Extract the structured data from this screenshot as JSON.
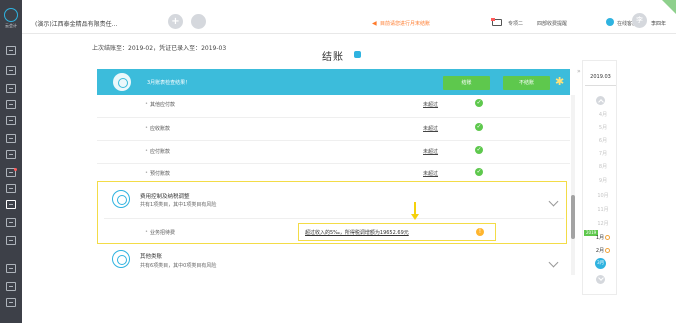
{
  "app": {
    "logo_text": "云会计"
  },
  "header": {
    "company": "(演示)江西泰金精品有限责任...",
    "add_symbol": "+",
    "notice": "目前请您进行月末结账",
    "links": [
      "专项二",
      "四部收费提醒",
      "在线客服"
    ],
    "avatar_initial": "李",
    "username": "李四年"
  },
  "colors": {
    "accent": "#3cbcdb",
    "success": "#5ec84d",
    "warning": "#ffb52e",
    "highlight": "#f3dc47"
  },
  "subheader": {
    "info": "上次结账至：2019-02，凭证已录入至：2019-03"
  },
  "page": {
    "title": "结账"
  },
  "banner": {
    "text": "3月账表检查结果！",
    "btn_primary": "结账",
    "btn_secondary": "不结账"
  },
  "check_rows": [
    {
      "label": "其他应付款",
      "status": "未超过",
      "icon": "check-icon"
    },
    {
      "label": "应收账款",
      "status": "未超过",
      "icon": "check-icon"
    },
    {
      "label": "应付账款",
      "status": "未超过",
      "icon": "check-icon"
    },
    {
      "label": "预付账款",
      "status": "未超过",
      "icon": "check-icon"
    }
  ],
  "expense_group": {
    "title": "费用控制及纳税调整",
    "subtitle": "共有1项类目，其中1项类目有风险",
    "item_label": "业务招待费",
    "item_status": "超过收入的5‰，所得税调增额为19652.69元"
  },
  "other_group": {
    "title": "其他类账",
    "subtitle": "共有6项类目，其中0项类目有风险"
  },
  "months": {
    "header": "2019.03",
    "list": [
      "4月",
      "5月",
      "6月",
      "7月",
      "8月",
      "9月",
      "10月",
      "11月",
      "12月"
    ],
    "year_tag": "2019",
    "done": [
      "1月",
      "2月"
    ],
    "current": "3月"
  }
}
